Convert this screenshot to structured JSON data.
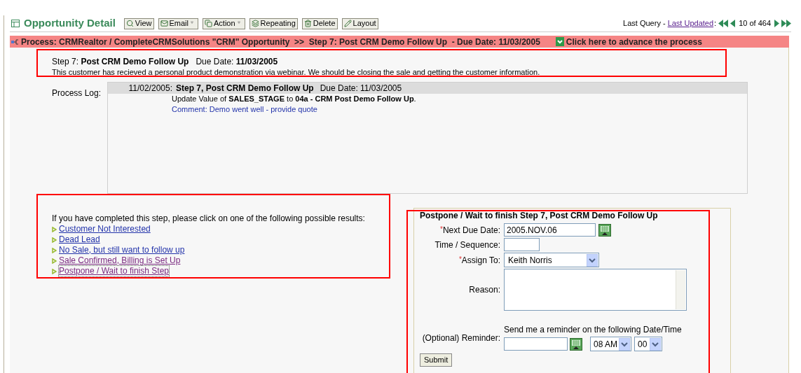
{
  "header": {
    "title": "Opportunity Detail",
    "toolbar": [
      {
        "label": "View",
        "kind": "button"
      },
      {
        "label": "Email",
        "kind": "dropdown"
      },
      {
        "label": "Action",
        "kind": "dropdown"
      },
      {
        "label": "Repeating",
        "kind": "button"
      },
      {
        "label": "Delete",
        "kind": "button"
      },
      {
        "label": "Layout",
        "kind": "button"
      }
    ],
    "nav": {
      "prefix": "Last Query -",
      "link": "Last Updated",
      "suffix": ":",
      "position": "10 of 464"
    }
  },
  "process_bar": {
    "text": "Process: CRMRealtor / CompleteCRMSolutions \"CRM\" Opportunity  >>  Step 7: Post CRM Demo Follow Up  - Due Date: 11/03/2005",
    "action": "Click here to advance the process"
  },
  "step": {
    "line": "Step 7: **Post CRM Demo Follow Up**   Due Date: **11/03/2005**",
    "description": "This customer has recieved a personal product demonstration via webinar. We should be closing the sale and getting the customer information."
  },
  "process_log": {
    "label": "Process Log:",
    "entries": [
      {
        "date": "11/02/2005:",
        "title": "Step 7, Post CRM Demo Follow Up",
        "due": "Due Date: 11/03/2005",
        "update": "Update Value of **SALES_STAGE** to **04a - CRM Post Demo Follow Up**.",
        "comment": "Comment: Demo went well - provide quote"
      }
    ]
  },
  "results": {
    "prompt": "If you have completed this step, please click on one of the following possible results:",
    "links": [
      {
        "label": "Customer Not Interested",
        "visited": false,
        "focused": false
      },
      {
        "label": "Dead Lead",
        "visited": false,
        "focused": false
      },
      {
        "label": "No Sale, but still want to follow up",
        "visited": false,
        "focused": false
      },
      {
        "label": "Sale Confirmed, Billing is Set Up",
        "visited": true,
        "focused": false
      },
      {
        "label": "Postpone / Wait to finish Step",
        "visited": true,
        "focused": true
      }
    ]
  },
  "postpone_form": {
    "title": "Postpone / Wait to finish Step 7, Post CRM Demo Follow Up",
    "fields": [
      {
        "kind": "date",
        "required_mark": "*",
        "label": "Next Due Date:",
        "value": "2005.NOV.06"
      },
      {
        "kind": "text",
        "label": "Time / Sequence:"
      },
      {
        "kind": "select",
        "required_mark": "*",
        "label": "Assign To:",
        "value": "Keith Norris"
      },
      {
        "kind": "textarea",
        "label": "Reason:"
      },
      {
        "kind": "reminder",
        "label": "(Optional) Reminder:",
        "hint": "Send me a reminder on the following Date/Time",
        "hour": "08 AM",
        "minute": "00"
      }
    ],
    "submit": "Submit"
  }
}
